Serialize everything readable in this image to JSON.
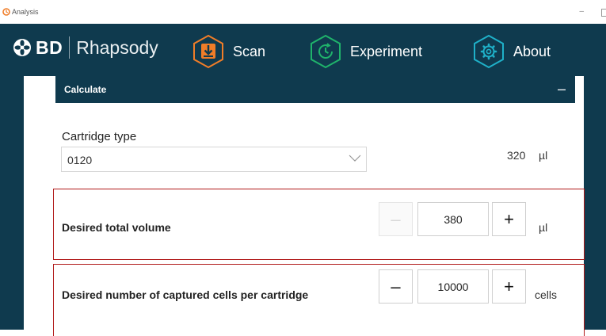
{
  "window": {
    "title": "Analysis"
  },
  "header": {
    "brand_bd": "BD",
    "brand_name": "Rhapsody",
    "nav": [
      {
        "label": "Scan",
        "icon": "scan-download-icon",
        "color": "#f07d28"
      },
      {
        "label": "Experiment",
        "icon": "experiment-timer-icon",
        "color": "#1fb36b"
      },
      {
        "label": "About",
        "icon": "gear-icon",
        "color": "#1fb0c8"
      }
    ],
    "background": "#0f3a4e"
  },
  "calculate": {
    "title": "Calculate",
    "collapse_symbol": "–"
  },
  "cartridge": {
    "label": "Cartridge type",
    "selected": "0120",
    "volume": "320",
    "volume_unit": "µl"
  },
  "total_volume": {
    "label": "Desired total volume",
    "value": "380",
    "unit": "µl",
    "minus": "–",
    "plus": "+",
    "minus_disabled": true
  },
  "captured_cells": {
    "label": "Desired number of captured cells per cartridge",
    "value": "10000",
    "unit": "cells",
    "minus": "–",
    "plus": "+"
  },
  "colors": {
    "highlight_border": "#b11a1a"
  }
}
